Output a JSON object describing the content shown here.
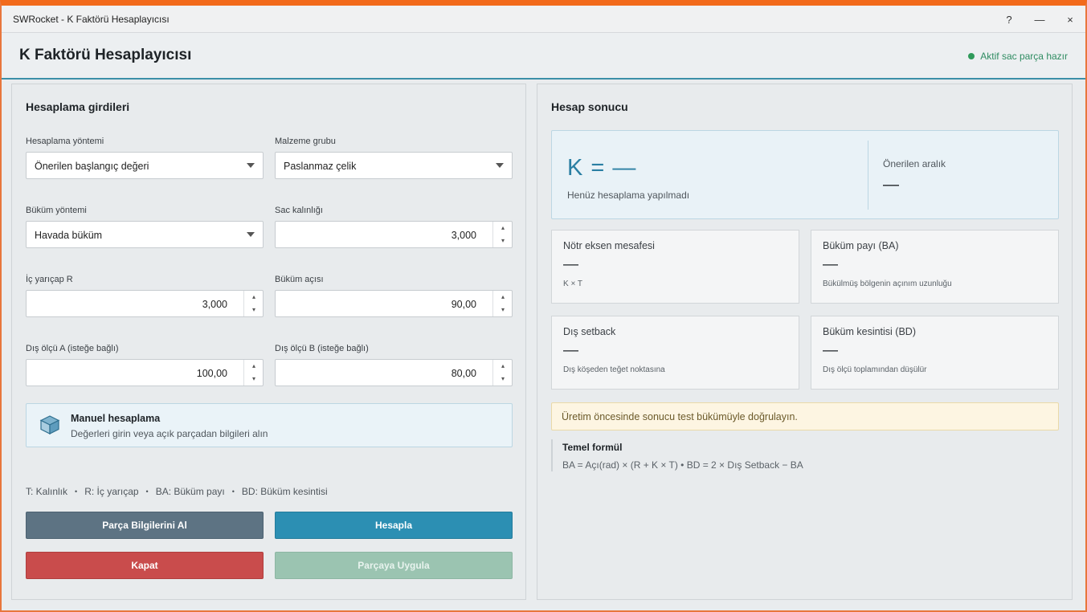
{
  "window": {
    "title": "SWRocket - K Faktörü Hesaplayıcısı",
    "help_glyph": "?",
    "minimize_glyph": "—",
    "close_glyph": "×",
    "accent_color": "#f26a1b"
  },
  "header": {
    "title": "K Faktörü Hesaplayıcısı",
    "status_text": "Aktif sac parça hazır",
    "status_color": "#2f9a5a"
  },
  "inputs_panel": {
    "heading": "Hesaplama girdileri",
    "method": {
      "label": "Hesaplama yöntemi",
      "value": "Önerilen başlangıç değeri"
    },
    "material": {
      "label": "Malzeme grubu",
      "value": "Paslanmaz çelik"
    },
    "bend_method": {
      "label": "Büküm yöntemi",
      "value": "Havada büküm"
    },
    "thickness": {
      "label": "Sac kalınlığı",
      "value": "3,000"
    },
    "inner_radius": {
      "label": "İç yarıçap R",
      "value": "3,000"
    },
    "bend_angle": {
      "label": "Büküm açısı",
      "value": "90,00"
    },
    "outer_a": {
      "label": "Dış ölçü A (isteğe bağlı)",
      "value": "100,00"
    },
    "outer_b": {
      "label": "Dış ölçü B (isteğe bağlı)",
      "value": "80,00"
    },
    "spin_up": "▴",
    "spin_down": "▾",
    "manual": {
      "icon": "cube-icon",
      "title": "Manuel hesaplama",
      "subtitle": "Değerleri girin veya açık parçadan bilgileri alın"
    },
    "legend": {
      "items": [
        "T: Kalınlık",
        "R: İç yarıçap",
        "BA: Büküm payı",
        "BD: Büküm kesintisi"
      ],
      "separator": "•"
    },
    "buttons": {
      "get_info": "Parça Bilgilerini Al",
      "calculate": "Hesapla",
      "close": "Kapat",
      "apply": "Parçaya Uygula"
    }
  },
  "result_panel": {
    "heading": "Hesap sonucu",
    "k_value": "K = —",
    "k_subtitle": "Henüz hesaplama yapılmadı",
    "range_label": "Önerilen aralık",
    "range_value": "—",
    "cards": [
      {
        "title": "Nötr eksen mesafesi",
        "value": "—",
        "sub": "K × T"
      },
      {
        "title": "Büküm payı (BA)",
        "value": "—",
        "sub": "Bükülmüş bölgenin açınım uzunluğu"
      },
      {
        "title": "Dış setback",
        "value": "—",
        "sub": "Dış köşeden teğet noktasına"
      },
      {
        "title": "Büküm kesintisi (BD)",
        "value": "—",
        "sub": "Dış ölçü toplamından düşülür"
      }
    ],
    "warning": "Üretim öncesinde sonucu test bükümüyle doğrulayın.",
    "formula": {
      "title": "Temel formül",
      "text": "BA = Açı(rad) × (R + K × T)   •   BD = 2 × Dış Setback − BA"
    }
  }
}
